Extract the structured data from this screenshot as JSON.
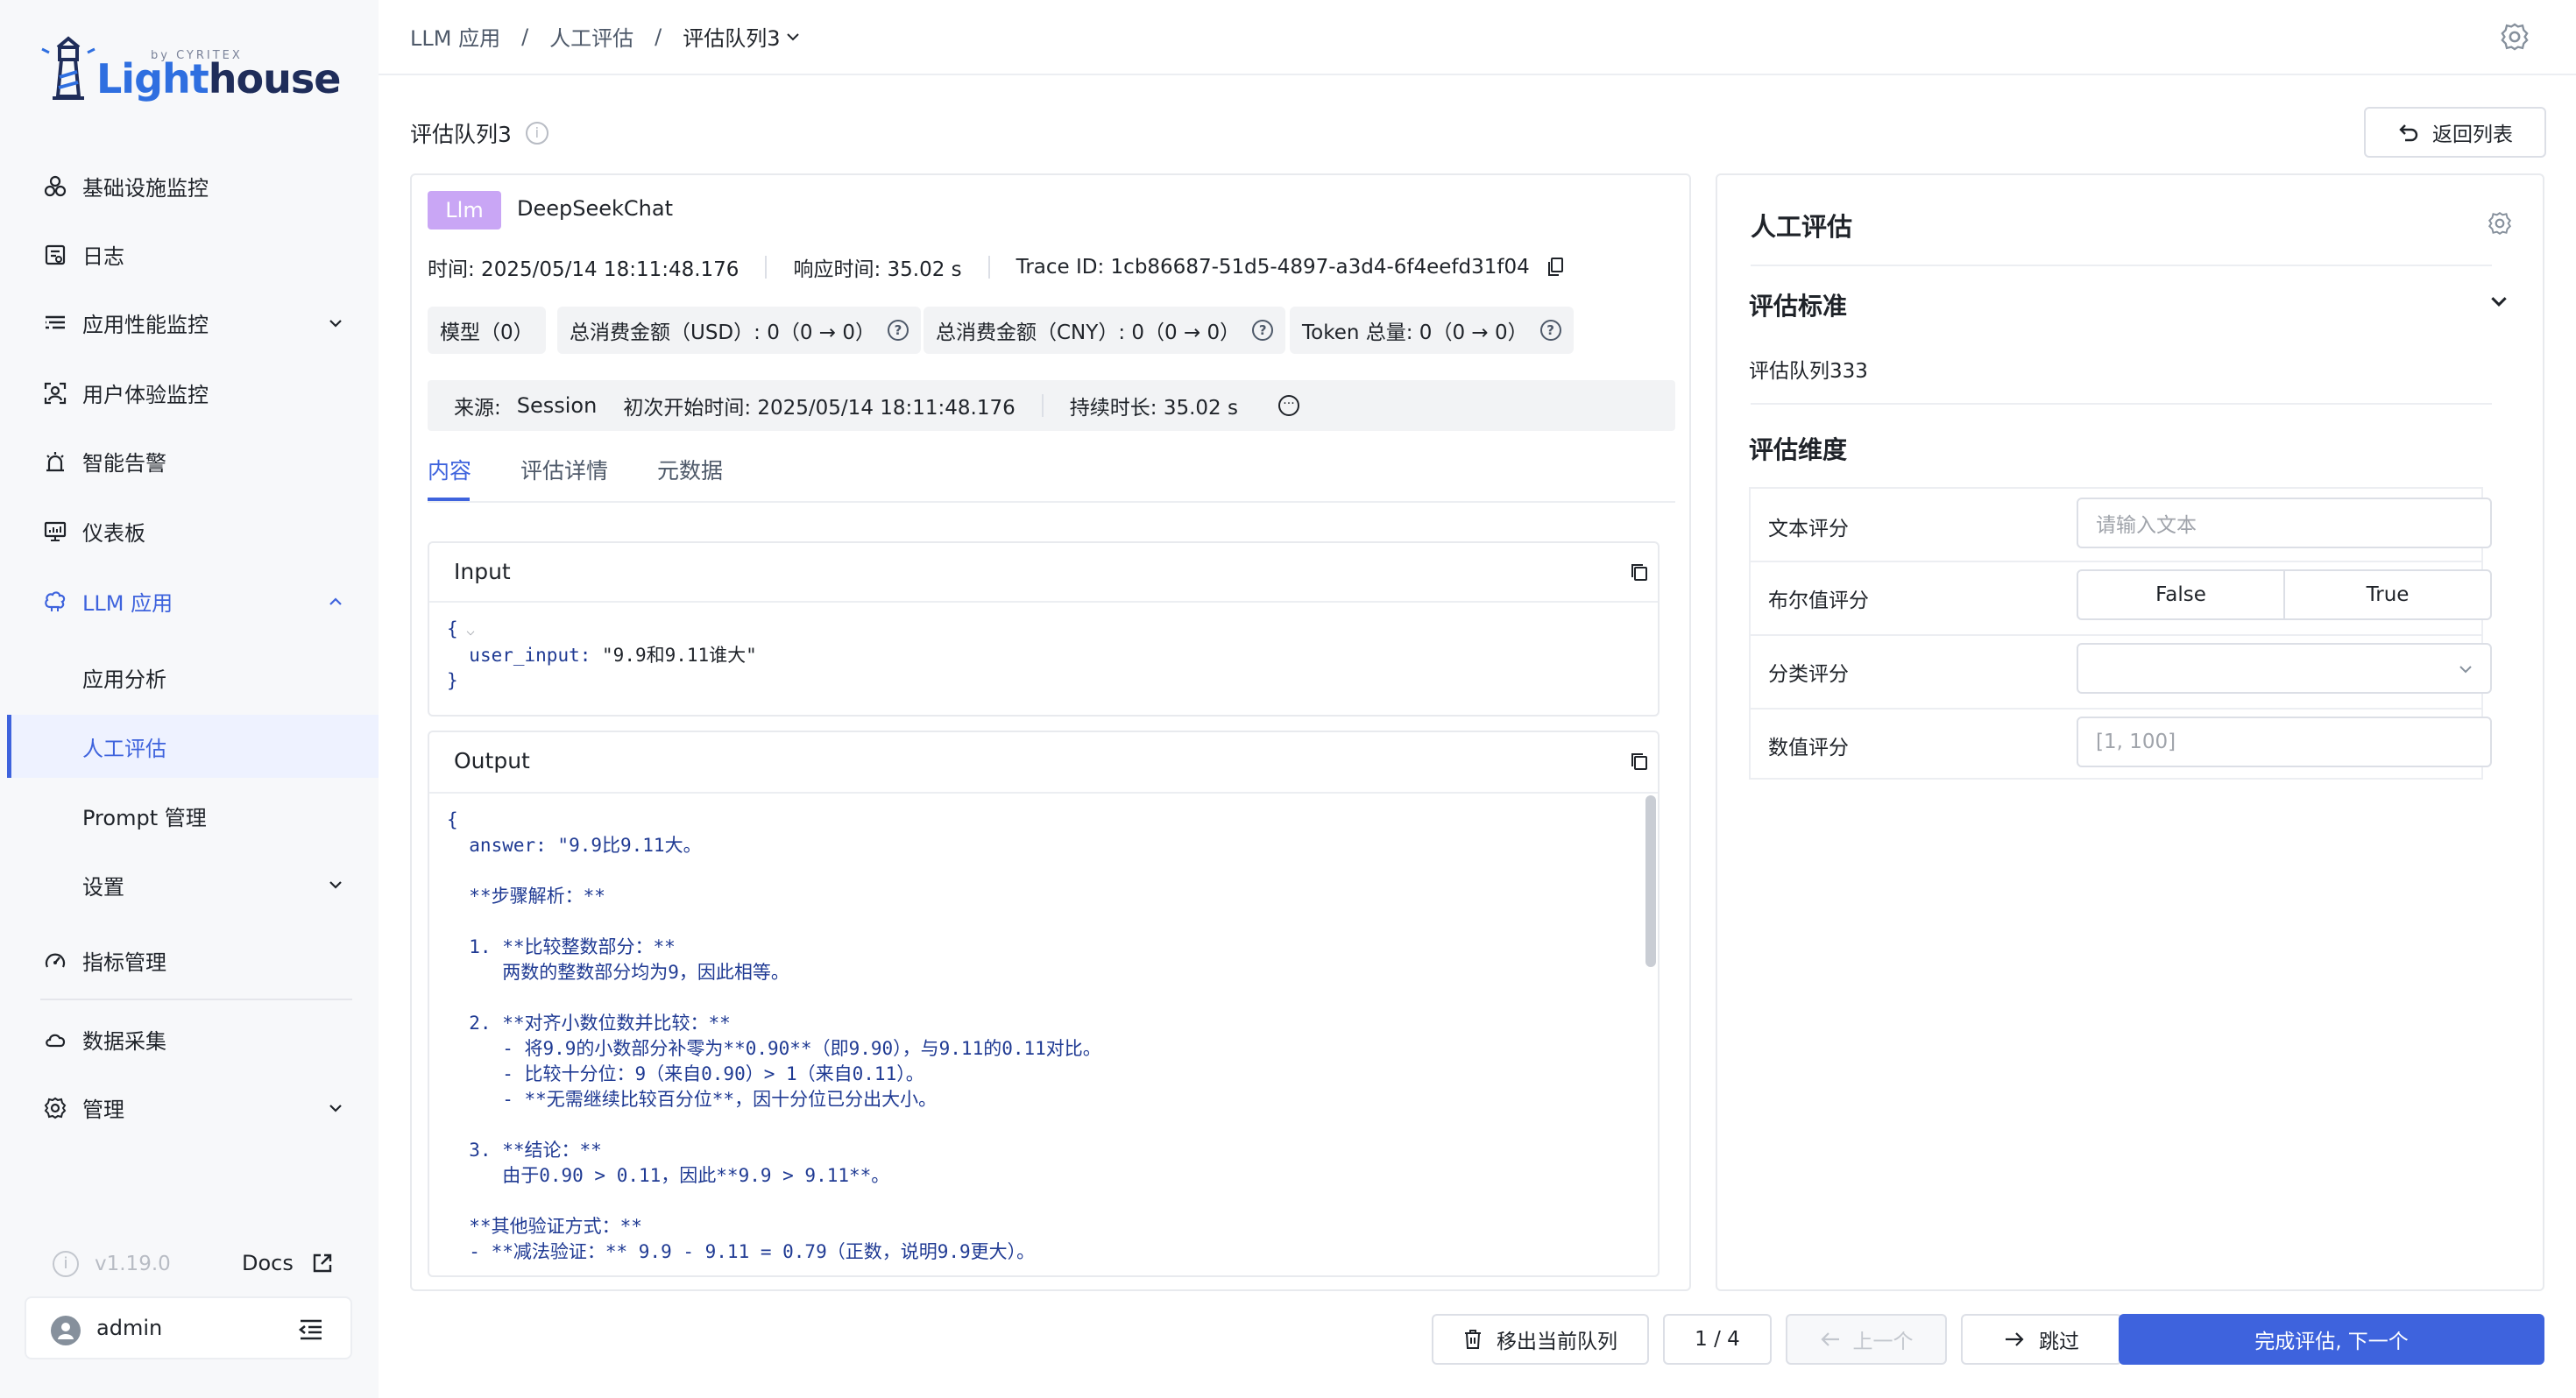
{
  "brand": {
    "name_part1": "Light",
    "name_part2": "house",
    "sub": "by CYRITEX"
  },
  "nav": {
    "infra": "基础设施监控",
    "logs": "日志",
    "apm": "应用性能监控",
    "rum": "用户体验监控",
    "alerts": "智能告警",
    "dashboard": "仪表板",
    "llm": "LLM 应用",
    "llm_sub": {
      "analysis": "应用分析",
      "human_eval": "人工评估",
      "prompt": "Prompt 管理",
      "settings": "设置"
    },
    "metrics": "指标管理",
    "collect": "数据采集",
    "manage": "管理"
  },
  "footer": {
    "version": "v1.19.0",
    "docs": "Docs",
    "user": "admin"
  },
  "breadcrumb": {
    "b1": "LLM 应用",
    "sep": "/",
    "b2": "人工评估",
    "b3": "评估队列3"
  },
  "page": {
    "title": "评估队列3",
    "back": "返回列表"
  },
  "trace": {
    "tag": "Llm",
    "name": "DeepSeekChat",
    "time": "时间: 2025/05/14 18:11:48.176",
    "latency": "响应时间: 35.02 s",
    "trace_id": "Trace ID: 1cb86687-51d5-4897-a3d4-6f4eefd31f04",
    "chips": {
      "model": "模型（0）",
      "usd": "总消费金额（USD）: 0（0 → 0）",
      "cny": "总消费金额（CNY）: 0（0 → 0）",
      "tokens": "Token 总量: 0（0 → 0）"
    },
    "source_label": "来源:",
    "source_value": "Session",
    "start": "初次开始时间: 2025/05/14 18:11:48.176",
    "duration": "持续时长: 35.02 s"
  },
  "tabs": {
    "content": "内容",
    "detail": "评估详情",
    "meta": "元数据"
  },
  "input": {
    "title": "Input",
    "l1": "{",
    "key": "user_input",
    "val": "\"9.9和9.11谁大\"",
    "l3": "}"
  },
  "output": {
    "title": "Output",
    "lines": [
      "{",
      "  answer: \"9.9比9.11大。",
      "",
      "  **步骤解析：**",
      "",
      "  1. **比较整数部分：**",
      "     两数的整数部分均为9，因此相等。",
      "",
      "  2. **对齐小数位数并比较：**",
      "     - 将9.9的小数部分补零为**0.90**（即9.90），与9.11的0.11对比。",
      "     - 比较十分位：9（来自0.90）> 1（来自0.11）。",
      "     - **无需继续比较百分位**，因十分位已分出大小。",
      "",
      "  3. **结论：**",
      "     由于0.90 > 0.11，因此**9.9 > 9.11**。",
      "",
      "  **其他验证方式：**",
      "  - **减法验证：** 9.9 - 9.11 = 0.79（正数，说明9.9更大）。"
    ]
  },
  "eval": {
    "title": "人工评估",
    "criteria_title": "评估标准",
    "criteria_text": "评估队列333",
    "dims_title": "评估维度",
    "text_label": "文本评分",
    "text_placeholder": "请输入文本",
    "bool_label": "布尔值评分",
    "bool_false": "False",
    "bool_true": "True",
    "cat_label": "分类评分",
    "num_label": "数值评分",
    "num_placeholder": "[1, 100]"
  },
  "actions": {
    "remove": "移出当前队列",
    "page": "1 / 4",
    "prev": "上一个",
    "skip": "跳过",
    "finish": "完成评估, 下一个"
  },
  "colors": {
    "primary": "#3e63dd",
    "tag_bg": "#c9a6f5"
  }
}
